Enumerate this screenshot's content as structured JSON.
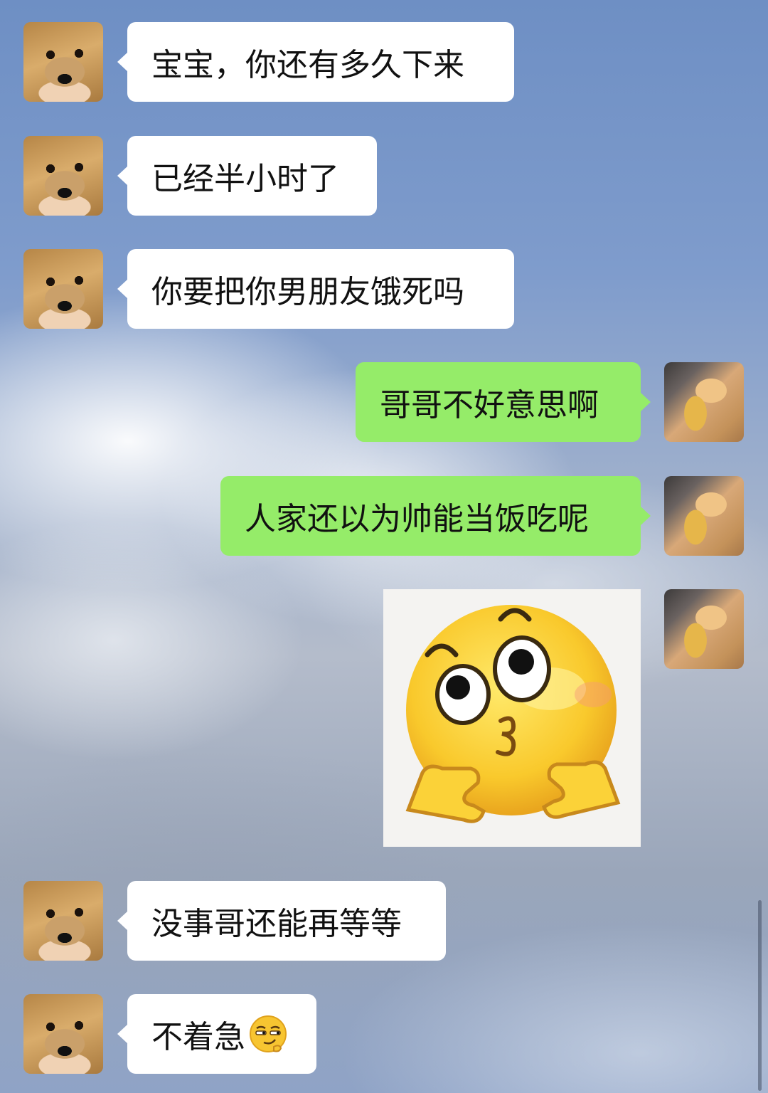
{
  "messages": [
    {
      "side": "left",
      "avatar": "dog-avatar",
      "text": "宝宝，你还有多久下来"
    },
    {
      "side": "left",
      "avatar": "dog-avatar",
      "text": "已经半小时了"
    },
    {
      "side": "left",
      "avatar": "dog-avatar",
      "text": "你要把你男朋友饿死吗"
    },
    {
      "side": "right",
      "avatar": "cat-avatar",
      "text": "哥哥不好意思啊"
    },
    {
      "side": "right",
      "avatar": "cat-avatar",
      "text": "人家还以为帅能当饭吃呢"
    },
    {
      "side": "right",
      "avatar": "cat-avatar",
      "sticker": "thinking-emoji-sticker"
    },
    {
      "side": "left",
      "avatar": "dog-avatar",
      "text": "没事哥还能再等等"
    },
    {
      "side": "left",
      "avatar": "dog-avatar",
      "text": "不着急",
      "inline_emoji": "smirk-emoji"
    }
  ],
  "colors": {
    "sent_bubble": "#95ec69",
    "received_bubble": "#ffffff"
  }
}
